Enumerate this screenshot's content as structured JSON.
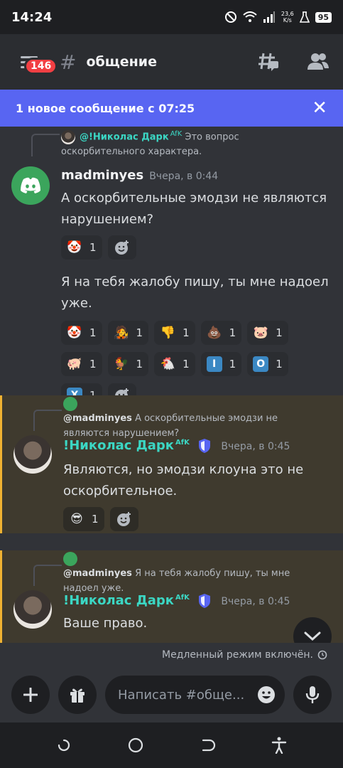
{
  "status": {
    "time": "14:24",
    "speed_top": "23,6",
    "speed_bottom": "K/s",
    "battery": "95"
  },
  "header": {
    "badge": "146",
    "hash": "#",
    "channel": "общение"
  },
  "banner": {
    "text": "1 новое сообщение с 07:25",
    "close": "✕"
  },
  "messages": [
    {
      "reply": {
        "name": "@!Николас Дарк",
        "afk": "AfK",
        "text": "Это вопрос оскорбительного характера."
      },
      "author": "madminyes",
      "time": "Вчера, в 0:44",
      "text": "А оскорбительные эмодзи не являются нарушением?",
      "reactions": [
        {
          "emoji": "🤡",
          "count": "1"
        }
      ],
      "text2": "Я на тебя жалобу пишу, ты мне надоел уже.",
      "reactions2": [
        {
          "emoji": "🤡",
          "count": "1"
        },
        {
          "emoji": "🧑‍🎤",
          "count": "1"
        },
        {
          "emoji": "👎",
          "count": "1"
        },
        {
          "emoji": "💩",
          "count": "1"
        },
        {
          "emoji": "🐷",
          "count": "1"
        },
        {
          "emoji": "🐖",
          "count": "1"
        },
        {
          "emoji": "🐓",
          "count": "1"
        },
        {
          "emoji": "🐔",
          "count": "1"
        },
        {
          "emoji": "I",
          "count": "1"
        },
        {
          "emoji": "O",
          "count": "1"
        },
        {
          "emoji": "X",
          "count": "1"
        }
      ]
    },
    {
      "reply": {
        "name": "@madminyes",
        "text": "А оскорбительные эмодзи не являются нарушением?"
      },
      "author": "!Николас Дарк",
      "afk": "AfK",
      "time": "Вчера, в 0:45",
      "text": "Являются, но эмодзи клоуна это не оскорбительное.",
      "reactions": [
        {
          "emoji": "😎",
          "count": "1"
        }
      ]
    },
    {
      "reply": {
        "name": "@madminyes",
        "text": "Я на тебя жалобу пишу, ты мне надоел уже."
      },
      "author": "!Николас Дарк",
      "afk": "AfK",
      "time": "Вчера, в 0:45",
      "text": "Ваше право."
    }
  ],
  "slowmode": "Медленный режим включён.",
  "composer": {
    "placeholder": "Написать #обще..."
  },
  "colors": {
    "accent": "#5865f2",
    "mention_bar": "#f0b232",
    "teal_name": "#3bd7c4",
    "badge": "#f23f43"
  }
}
